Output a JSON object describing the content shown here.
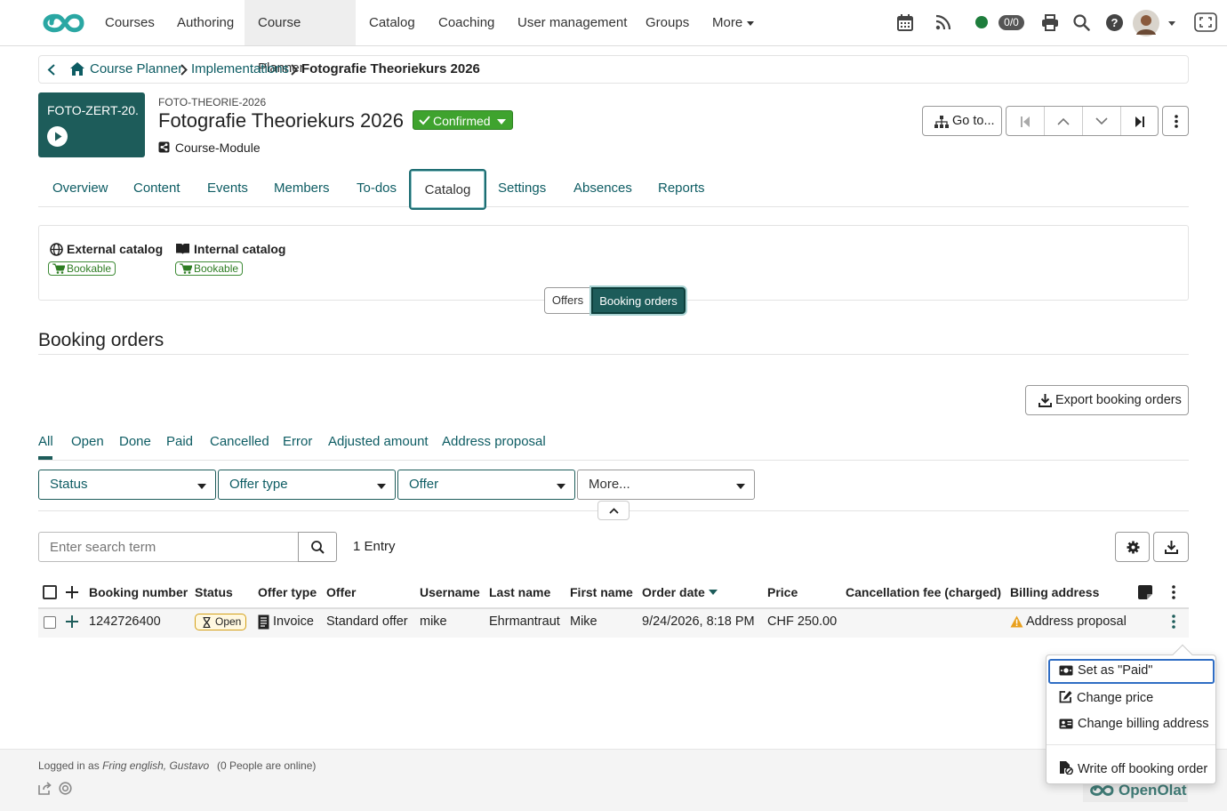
{
  "nav": {
    "items": [
      "Courses",
      "Authoring",
      "Course Planner",
      "Catalog",
      "Coaching",
      "User management",
      "Groups"
    ],
    "more_label": "More",
    "active": "Course Planner",
    "points_badge": "0/0",
    "icons": [
      "calendar-icon",
      "rss-icon",
      "online-status-icon",
      "print-icon",
      "search-icon",
      "help-icon",
      "avatar",
      "fullscreen-icon"
    ]
  },
  "breadcrumb": {
    "items": [
      "Course Planner",
      "Implementations"
    ],
    "current": "Fotografie Theoriekurs 2026"
  },
  "header": {
    "tile_name": "FOTO-ZERT-20...",
    "external_ref": "FOTO-THEORIE-2026",
    "title": "Fotografie Theoriekurs 2026",
    "status": "Confirmed",
    "module": "Course-Module",
    "goto_label": "Go to..."
  },
  "tabs": [
    "Overview",
    "Content",
    "Events",
    "Members",
    "To-dos",
    "Catalog",
    "Settings",
    "Absences",
    "Reports"
  ],
  "active_tab": "Catalog",
  "catalog": {
    "external_title": "External catalog",
    "external_badge": "Bookable",
    "internal_title": "Internal catalog",
    "internal_badge": "Bookable",
    "segments": [
      "Offers",
      "Booking orders"
    ],
    "active_segment": "Booking orders"
  },
  "section_title": "Booking orders",
  "export_label": "Export booking orders",
  "filter_tabs": [
    "All",
    "Open",
    "Done",
    "Paid",
    "Cancelled",
    "Error",
    "Adjusted amount",
    "Address proposal"
  ],
  "active_filter": "All",
  "filters": [
    "Status",
    "Offer type",
    "Offer",
    "More..."
  ],
  "search": {
    "placeholder": "Enter search term",
    "count": "1 Entry"
  },
  "table": {
    "headers": [
      "Booking number",
      "Status",
      "Offer type",
      "Offer",
      "Username",
      "Last name",
      "First name",
      "Order date",
      "Price",
      "Cancellation fee (charged)",
      "Billing address"
    ],
    "sorted_column": "Order date",
    "rows": [
      {
        "booking_number": "1242726400",
        "status": "Open",
        "offer_type": "Invoice",
        "offer": "Standard offer",
        "username": "mike",
        "last_name": "Ehrmantraut",
        "first_name": "Mike",
        "order_date": "9/24/2026, 8:18 PM",
        "price": "CHF 250.00",
        "cancellation_fee": "",
        "billing_address": "Address proposal"
      }
    ]
  },
  "menu": [
    "Set as \"Paid\"",
    "Change price",
    "Change billing address",
    "Write off booking order"
  ],
  "footer": {
    "logged_in_prefix": "Logged in as",
    "logged_in_user": "Fring english, Gustavo",
    "online": "(0 People are online)",
    "brand": "OpenOlat"
  },
  "colors": {
    "accent": "#1d5c5a",
    "link": "#0d5c63",
    "confirmed": "#3fa32e",
    "focus": "#2f6dc4"
  }
}
